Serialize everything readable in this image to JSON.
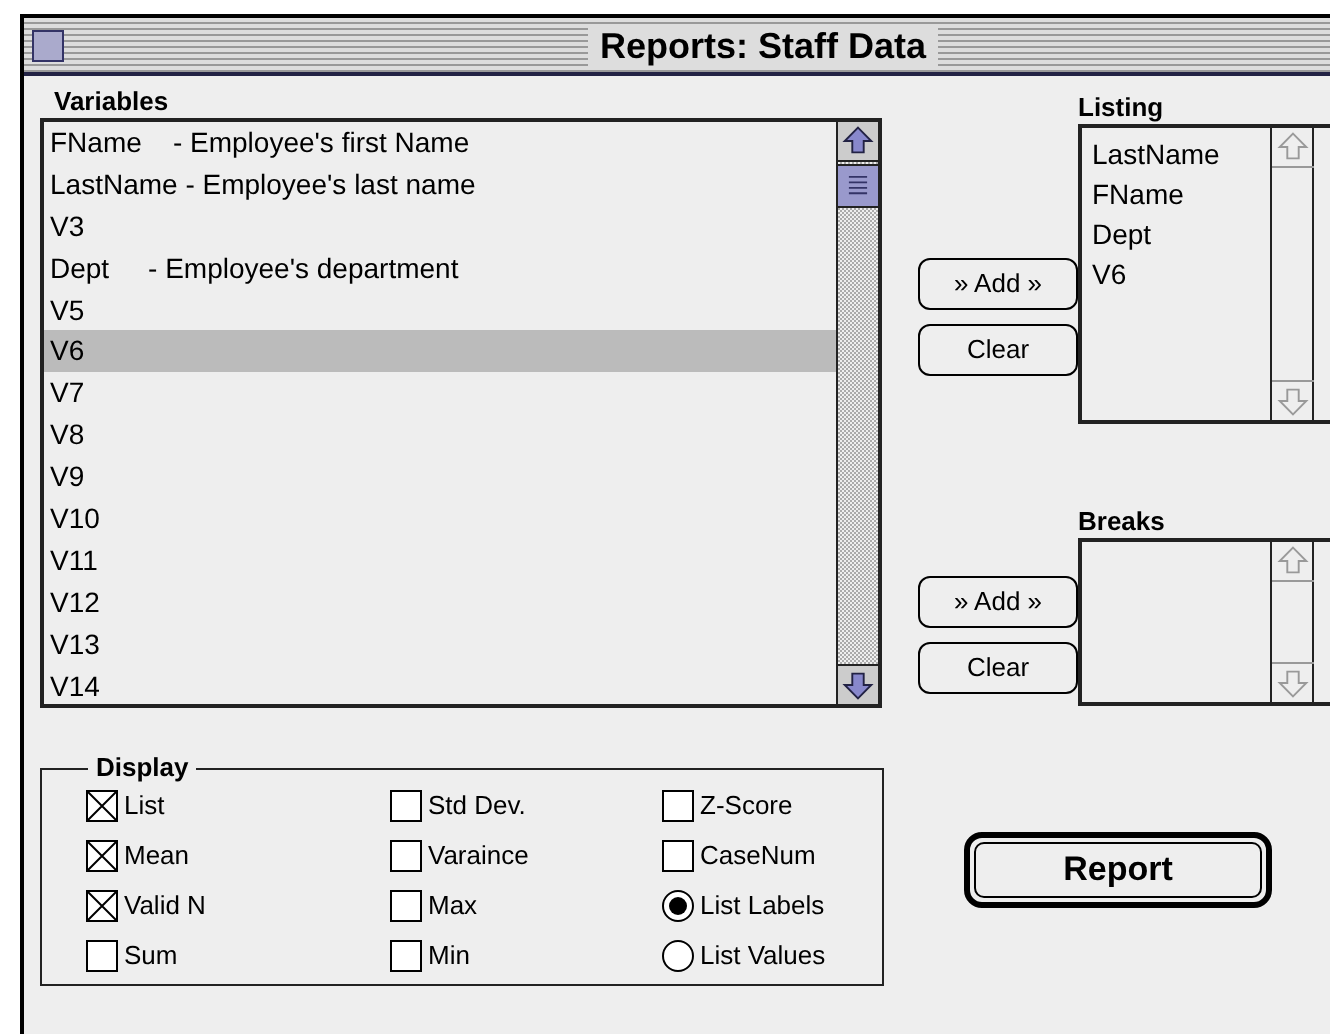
{
  "window": {
    "title": "Reports: Staff Data"
  },
  "variables": {
    "label": "Variables",
    "items": [
      {
        "text": "FName    - Employee's first Name",
        "selected": false
      },
      {
        "text": "LastName - Employee's last name",
        "selected": false
      },
      {
        "text": "V3",
        "selected": false
      },
      {
        "text": "Dept     - Employee's department",
        "selected": false
      },
      {
        "text": "V5",
        "selected": false
      },
      {
        "text": "V6",
        "selected": true
      },
      {
        "text": "V7",
        "selected": false
      },
      {
        "text": "V8",
        "selected": false
      },
      {
        "text": "V9",
        "selected": false
      },
      {
        "text": "V10",
        "selected": false
      },
      {
        "text": "V11",
        "selected": false
      },
      {
        "text": "V12",
        "selected": false
      },
      {
        "text": "V13",
        "selected": false
      },
      {
        "text": "V14",
        "selected": false
      }
    ]
  },
  "listing": {
    "label": "Listing",
    "items": [
      "LastName",
      "FName",
      "Dept",
      "V6"
    ],
    "add_button": "» Add »",
    "clear_button": "Clear"
  },
  "breaks": {
    "label": "Breaks",
    "add_button": "» Add »",
    "clear_button": "Clear"
  },
  "display": {
    "label": "Display",
    "options": [
      {
        "label": "List",
        "kind": "checkbox",
        "checked": true
      },
      {
        "label": "Mean",
        "kind": "checkbox",
        "checked": true
      },
      {
        "label": "Valid N",
        "kind": "checkbox",
        "checked": true
      },
      {
        "label": "Sum",
        "kind": "checkbox",
        "checked": false
      },
      {
        "label": "Std Dev.",
        "kind": "checkbox",
        "checked": false
      },
      {
        "label": "Varaince",
        "kind": "checkbox",
        "checked": false
      },
      {
        "label": "Max",
        "kind": "checkbox",
        "checked": false
      },
      {
        "label": "Min",
        "kind": "checkbox",
        "checked": false
      },
      {
        "label": "Z-Score",
        "kind": "checkbox",
        "checked": false
      },
      {
        "label": "CaseNum",
        "kind": "checkbox",
        "checked": false
      },
      {
        "label": "List Labels",
        "kind": "radio",
        "checked": true
      },
      {
        "label": "List Values",
        "kind": "radio",
        "checked": false
      }
    ]
  },
  "report_button": "Report"
}
